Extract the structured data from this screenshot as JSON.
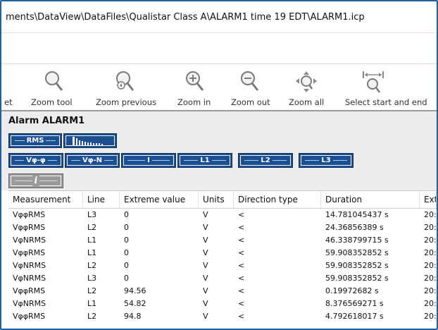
{
  "window": {
    "title": "ments\\DataView\\DataFiles\\Qualistar Class A\\ALARM1 time 19 EDT\\ALARM1.icp"
  },
  "toolbar": {
    "items": [
      {
        "label": "et",
        "icon": "none"
      },
      {
        "label": "Zoom tool",
        "icon": "magnifier-icon"
      },
      {
        "label": "Zoom previous",
        "icon": "zoom-previous-icon"
      },
      {
        "label": "Zoom in",
        "icon": "zoom-in-icon"
      },
      {
        "label": "Zoom out",
        "icon": "zoom-out-icon"
      },
      {
        "label": "Zoom all",
        "icon": "zoom-all-icon"
      },
      {
        "label": "Select start and end",
        "icon": "select-range-icon"
      }
    ]
  },
  "panel": {
    "title": "Alarm ALARM1",
    "buttons_row1": [
      {
        "label": "RMS"
      },
      {
        "label": "",
        "icon": "harmonics-icon"
      }
    ],
    "buttons_row2": [
      {
        "label": "Vφ-φ"
      },
      {
        "label": "Vφ-N"
      },
      {
        "label": "I"
      },
      {
        "label": "L1"
      },
      {
        "label": "L2"
      },
      {
        "label": "L3"
      }
    ],
    "info_button": {
      "label": "i",
      "icon": "info-icon"
    }
  },
  "table": {
    "columns": [
      "Measurement",
      "Line",
      "Extreme value",
      "Units",
      "Direction type",
      "Duration",
      "Ext"
    ],
    "rows": [
      [
        "VφφRMS",
        "L3",
        "0",
        "V",
        "<",
        "14.781045437 s",
        "20:"
      ],
      [
        "VφφRMS",
        "L2",
        "0",
        "V",
        "<",
        "24.36856389 s",
        "20:"
      ],
      [
        "VφNRMS",
        "L1",
        "0",
        "V",
        "<",
        "46.338799715 s",
        "20:"
      ],
      [
        "VφφRMS",
        "L1",
        "0",
        "V",
        "<",
        "59.908352852 s",
        "20:"
      ],
      [
        "VφNRMS",
        "L2",
        "0",
        "V",
        "<",
        "59.908352852 s",
        "20:"
      ],
      [
        "VφNRMS",
        "L3",
        "0",
        "V",
        "<",
        "59.908352852 s",
        "20:"
      ],
      [
        "VφφRMS",
        "L2",
        "94.56",
        "V",
        "<",
        "0.19972682 s",
        "20:"
      ],
      [
        "VφNRMS",
        "L1",
        "54.82",
        "V",
        "<",
        "8.376569271 s",
        "20:"
      ],
      [
        "VφφRMS",
        "L2",
        "94.8",
        "V",
        "<",
        "4.792618017 s",
        "20:"
      ]
    ]
  },
  "colors": {
    "button_blue": "#1b4f91",
    "frame_blue": "#1f5fa8",
    "panel_gray": "#ededed"
  }
}
